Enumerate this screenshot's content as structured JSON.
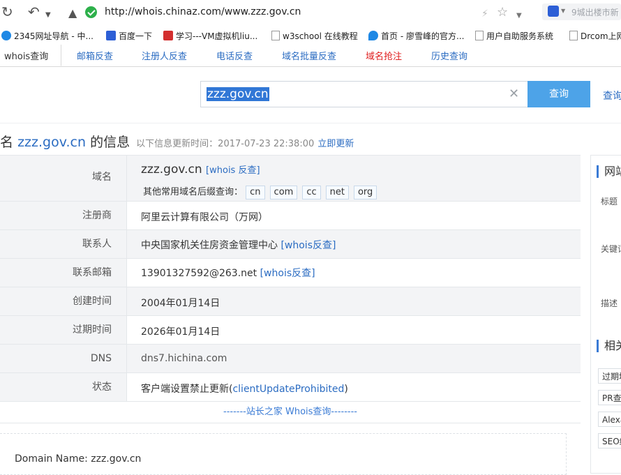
{
  "browser": {
    "url": "http://whois.chinaz.com/www.zzz.gov.cn",
    "search_placeholder": "9城出楼市新",
    "bookmarks": [
      {
        "label": "2345网址导航 - 中...",
        "color": "#1e88e5"
      },
      {
        "label": "百度一下",
        "color": "#2d5fd6"
      },
      {
        "label": "学习---VM虚拟机liu...",
        "color": "#d32f2f"
      },
      {
        "label": "w3school 在线教程",
        "color": "#9e9e9e"
      },
      {
        "label": "首页 - 廖雪峰的官方...",
        "color": "#1e88e5"
      },
      {
        "label": "用户自助服务系统",
        "color": "#9e9e9e"
      },
      {
        "label": "Drcom上网",
        "color": "#9e9e9e"
      }
    ]
  },
  "tabs": [
    {
      "label": "whois查询",
      "active": true
    },
    {
      "label": "邮箱反查"
    },
    {
      "label": "注册人反查"
    },
    {
      "label": "电话反查"
    },
    {
      "label": "域名批量反查"
    },
    {
      "label": "域名抢注",
      "red": true
    },
    {
      "label": "历史查询"
    }
  ],
  "search": {
    "value": "zzz.gov.cn",
    "button": "查询",
    "side_link": "查询"
  },
  "heading": {
    "prefix": "名",
    "domain": "zzz.gov.cn",
    "suffix": "的信息",
    "updated": "以下信息更新时间：2017-07-23 22:38:00",
    "update_link": "立即更新"
  },
  "whois": {
    "domain_label": "域名",
    "domain_value": "zzz.gov.cn",
    "whois_link": "[whois 反查]",
    "suffix_label": "其他常用域名后缀查询：",
    "suffixes": [
      "cn",
      "com",
      "cc",
      "net",
      "org"
    ],
    "registrar_label": "注册商",
    "registrar_value": "阿里云计算有限公司（万网）",
    "contact_label": "联系人",
    "contact_value": "中央国家机关住房资金管理中心",
    "contact_link": "[whois反查]",
    "email_label": "联系邮箱",
    "email_value": "13901327592@263.net",
    "email_link": "[whois反查]",
    "created_label": "创建时间",
    "created_value": "2004年01月14日",
    "expires_label": "过期时间",
    "expires_value": "2026年01月14日",
    "dns_label": "DNS",
    "dns_value": "dns7.hichina.com",
    "status_label": "状态",
    "status_prefix": "客户端设置禁止更新(",
    "status_code": "clientUpdateProhibited",
    "status_suffix": ")",
    "footer": "-------站长之家 Whois查询--------",
    "raw_line": "Domain Name: zzz.gov.cn"
  },
  "sidebar": {
    "title1": "网站",
    "label_title": "标题",
    "label_keywords": "关键词",
    "label_desc": "描述",
    "title2": "相关",
    "items": [
      "过期域名",
      "PR查询",
      "Alexa",
      "SEO综合"
    ]
  }
}
